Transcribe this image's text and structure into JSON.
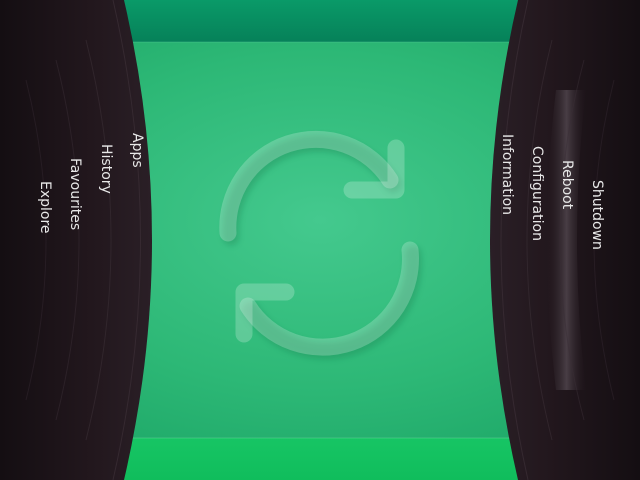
{
  "left_menu": {
    "items": [
      {
        "label": "Apps"
      },
      {
        "label": "History"
      },
      {
        "label": "Favourites"
      },
      {
        "label": "Explore"
      }
    ]
  },
  "right_menu": {
    "items": [
      {
        "label": "Information"
      },
      {
        "label": "Configuration"
      },
      {
        "label": "Reboot"
      },
      {
        "label": "Shutdown"
      }
    ]
  },
  "center": {
    "icon": "refresh-icon"
  },
  "colors": {
    "green_top": "#0a8c5e",
    "green_mid": "#2fbe7c",
    "green_bottom": "#14c460",
    "panel_dark": "#1c1318",
    "text": "#e8e8e8"
  }
}
